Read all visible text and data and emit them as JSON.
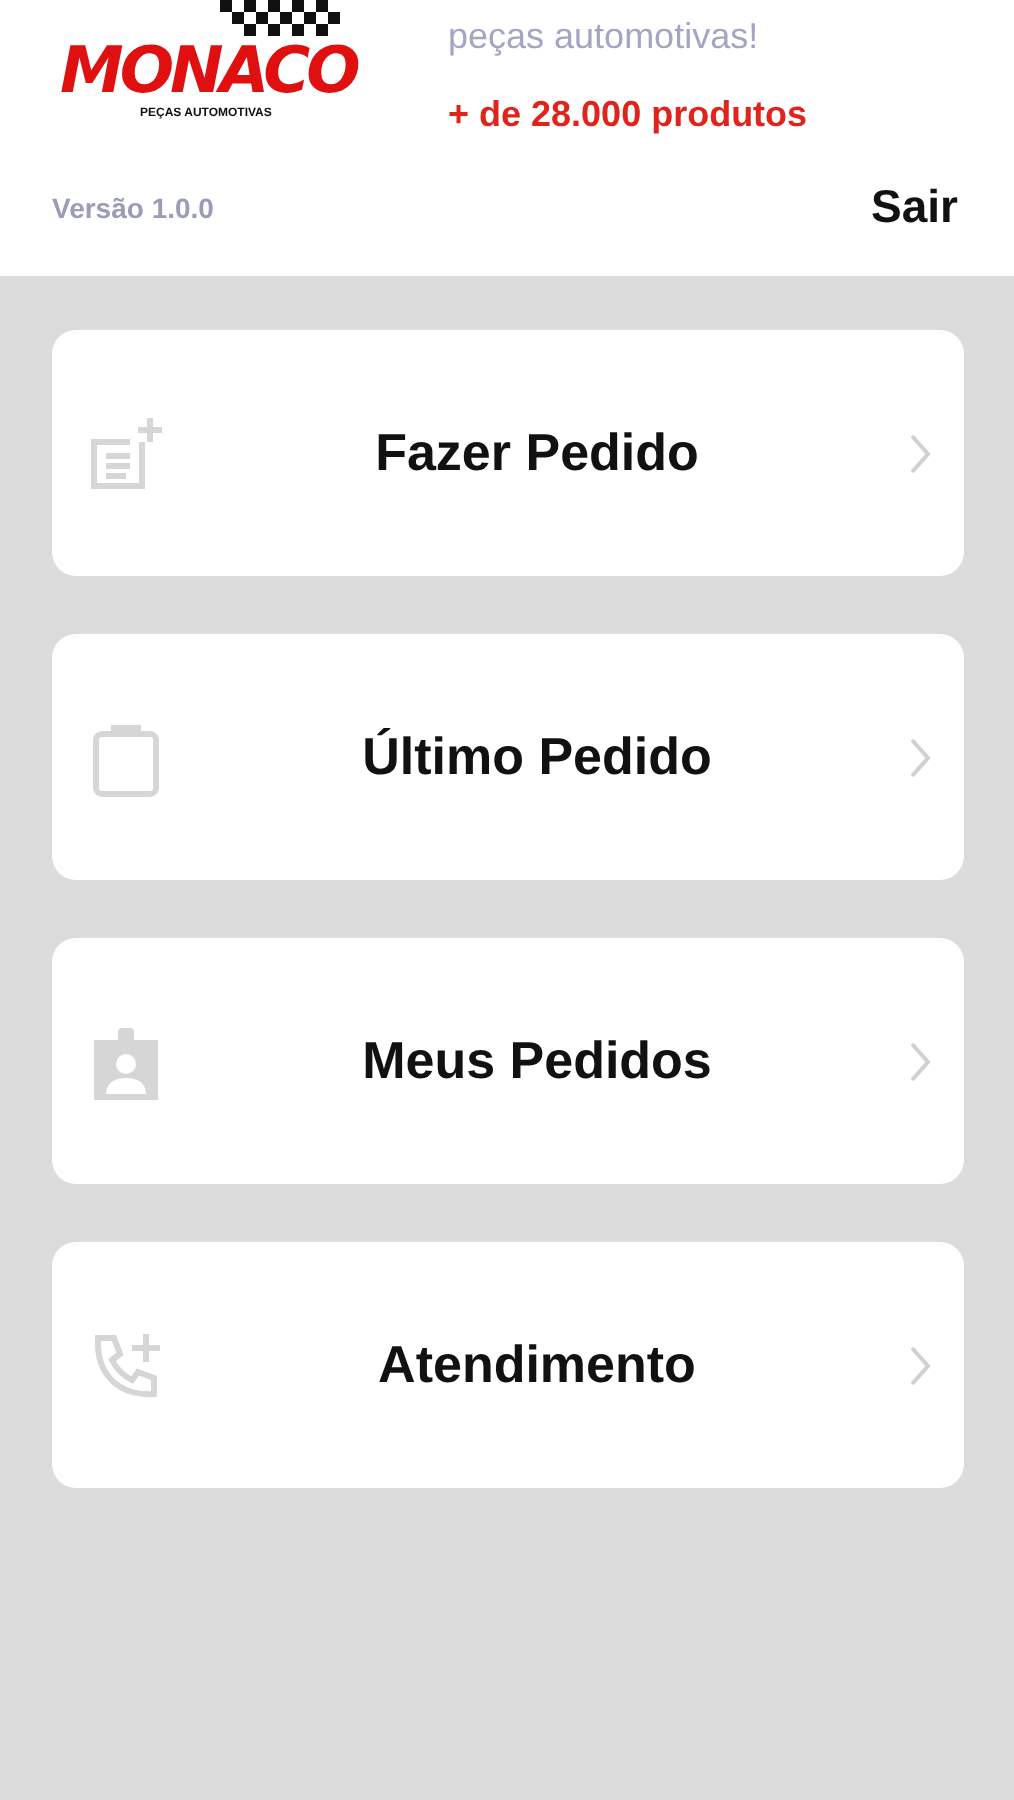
{
  "header": {
    "logo": {
      "name": "MONACO",
      "subtitle": "PEÇAS AUTOMOTIVAS"
    },
    "tagline": "peças automotivas!",
    "highlight": "+ de 28.000 produtos",
    "version": "Versão 1.0.0",
    "logout": "Sair"
  },
  "menu": [
    {
      "label": "Fazer Pedido",
      "kind": "new-order"
    },
    {
      "label": "Último Pedido",
      "kind": "clipboard"
    },
    {
      "label": "Meus Pedidos",
      "kind": "badge"
    },
    {
      "label": "Atendimento",
      "kind": "phone"
    }
  ]
}
